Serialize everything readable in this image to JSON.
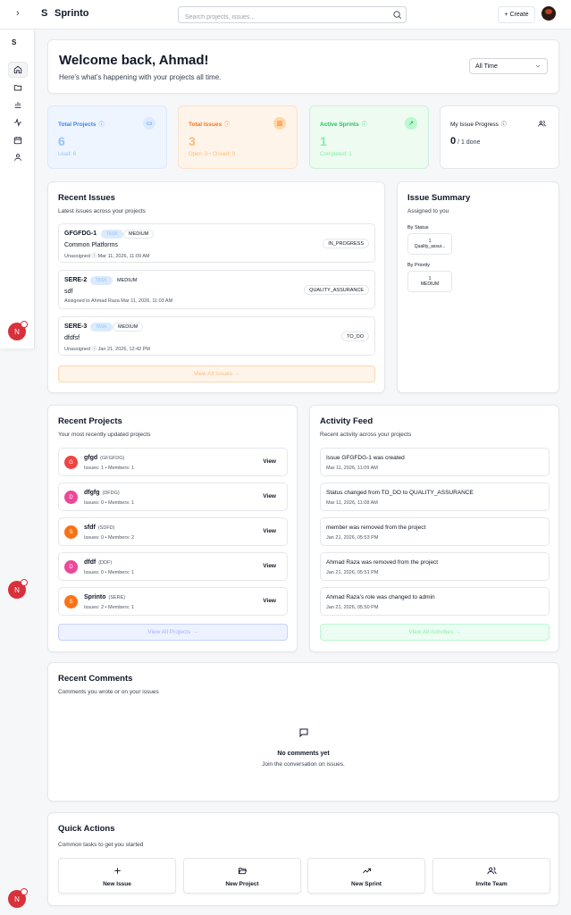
{
  "topbar": {
    "expand_icon": "chevron-right-icon",
    "logo": "S",
    "app_name": "Sprinto",
    "search_placeholder": "Search projects, issues...",
    "create_label": "+ Create"
  },
  "sidebar": {
    "logo": "S",
    "items": [
      "home-icon",
      "folder-icon",
      "chart-icon",
      "activity-icon",
      "calendar-icon",
      "user-icon"
    ],
    "user_initial": "N"
  },
  "welcome": {
    "title": "Welcome back, Ahmad!",
    "subtitle": "Here's what's happening with your projects all time.",
    "range": "All Time"
  },
  "stats": [
    {
      "label": "Total Projects",
      "value": "6",
      "sub": "Lead: 6",
      "color": "#3b82f6"
    },
    {
      "label": "Total Issues",
      "value": "3",
      "sub": "Open: 3 • Closed: 0",
      "color": "#f97316"
    },
    {
      "label": "Active Sprints",
      "value": "1",
      "sub": "Completed: 1",
      "color": "#22c55e"
    },
    {
      "label": "My Issue Progress",
      "value": "0",
      "sub": "/ 1 done"
    }
  ],
  "recent_issues": {
    "title": "Recent Issues",
    "subtitle": "Latest issues across your projects",
    "items": [
      {
        "key": "GFGFDG-1",
        "type": "TASK",
        "priority": "MEDIUM",
        "title": "Common Platforms",
        "meta": "Unassigned ⓘ    Mar 11, 2026, 11:09 AM",
        "status": "IN_PROGRESS"
      },
      {
        "key": "SERE-2",
        "type": "TASK",
        "priority": "MEDIUM",
        "title": "sdf",
        "meta": "Assigned to Ahmad Raza    Mar 11, 2026, 11:03 AM",
        "status": "QUALITY_ASSURANCE"
      },
      {
        "key": "SERE-3",
        "type": "TASK",
        "priority": "MEDIUM",
        "title": "dfdfsf",
        "meta": "Unassigned ⓘ    Jan 21, 2026, 12:42 PM",
        "status": "TO_DO"
      }
    ],
    "view_all": "View All Issues →"
  },
  "issue_summary": {
    "title": "Issue Summary",
    "subtitle": "Assigned to you",
    "by_status_label": "By Status",
    "status_count": "1",
    "status_name": "Quality_assur...",
    "by_priority_label": "By Priority",
    "priority_count": "1",
    "priority_name": "MEDIUM"
  },
  "recent_projects": {
    "title": "Recent Projects",
    "subtitle": "Your most recently updated projects",
    "items": [
      {
        "initial": "G",
        "name": "gfgd",
        "key": "(GFGFDG)",
        "meta": "Issues: 1 • Members: 1",
        "color": "#ef4444"
      },
      {
        "initial": "D",
        "name": "dfgfg",
        "key": "(DFDG)",
        "meta": "Issues: 0 • Members: 1",
        "color": "#ec4899"
      },
      {
        "initial": "S",
        "name": "sfdf",
        "key": "(SDFD)",
        "meta": "Issues: 0 • Members: 2",
        "color": "#f97316"
      },
      {
        "initial": "D",
        "name": "dfdf",
        "key": "(DDF)",
        "meta": "Issues: 0 • Members: 1",
        "color": "#ec4899"
      },
      {
        "initial": "S",
        "name": "Sprinto",
        "key": "(SERE)",
        "meta": "Issues: 2 • Members: 1",
        "color": "#f97316"
      }
    ],
    "view_label": "View",
    "view_all": "View All Projects →"
  },
  "activity_feed": {
    "title": "Activity Feed",
    "subtitle": "Recent activity across your projects",
    "items": [
      {
        "text": "Issue GFGFDG-1 was created",
        "time": "Mar 11, 2026, 11:09 AM"
      },
      {
        "text": "Status changed from TO_DO to QUALITY_ASSURANCE",
        "time": "Mar 11, 2026, 11:08 AM"
      },
      {
        "text": "member was removed from the project",
        "time": "Jan 21, 2026, 05:53 PM"
      },
      {
        "text": "Ahmad Raza was removed from the project",
        "time": "Jan 21, 2026, 05:51 PM"
      },
      {
        "text": "Ahmad Raza's role was changed to admin",
        "time": "Jan 21, 2026, 05:50 PM"
      }
    ],
    "view_all": "View All Activities →"
  },
  "recent_comments": {
    "title": "Recent Comments",
    "subtitle": "Comments you wrote or on your issues",
    "empty_title": "No comments yet",
    "empty_sub": "Join the conversation on issues."
  },
  "quick_actions": {
    "title": "Quick Actions",
    "subtitle": "Common tasks to get you started",
    "items": [
      {
        "label": "New Issue",
        "icon": "plus-icon"
      },
      {
        "label": "New Project",
        "icon": "folder-open-icon"
      },
      {
        "label": "New Sprint",
        "icon": "trending-up-icon"
      },
      {
        "label": "Invite Team",
        "icon": "users-icon"
      }
    ]
  }
}
